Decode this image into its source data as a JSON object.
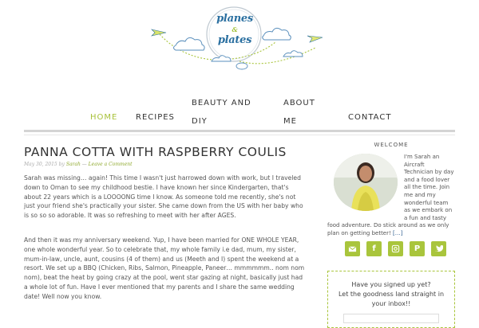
{
  "logo": {
    "line1": "planes",
    "amp": "&",
    "line2": "plates"
  },
  "nav": {
    "items": [
      {
        "label": "HOME",
        "active": true
      },
      {
        "label": "RECIPES",
        "active": false
      },
      {
        "label_line1": "BEAUTY AND",
        "label_line2": "DIY",
        "active": false
      },
      {
        "label_line1": "ABOUT",
        "label_line2": "ME",
        "active": false
      },
      {
        "label": "CONTACT",
        "active": false
      }
    ]
  },
  "post": {
    "title": "PANNA COTTA WITH RASPBERRY COULIS",
    "meta": {
      "date": "May 30, 2015",
      "by": "by",
      "author": "Sarah",
      "separator": "—",
      "comment": "Leave a Comment"
    },
    "paragraphs": [
      "Sarah was missing… again! This time I wasn't just harrowed down with work, but I traveled down to Oman to see my childhood bestie. I have known her since Kindergarten, that's about 22 years which is a LOOOONG time I know. As someone told me recently, she's not just your friend she's practically your sister. She came down from the US with her baby who is so so so adorable. It was so refreshing to meet with her after AGES.",
      "And then it was my anniversary weekend. Yup, I have been married for ONE WHOLE YEAR, one whole wonderful year. So to celebrate that, my whole family i.e dad, mum, my sister, mum-in-law, uncle, aunt, cousins (4 of them) and us (Meeth and I) spent the weekend at a resort. We set up a BBQ (Chicken, Ribs, Salmon, Pineapple, Paneer… mmmmmm.. nom nom nom), beat the heat by going crazy at the pool, went star gazing at night, basically just had a whole lot of fun. Have I ever mentioned that my parents and I share the same wedding date! Well now you know."
    ]
  },
  "sidebar": {
    "welcome_heading": "WELCOME",
    "intro_text": "I'm Sarah an Aircraft Technician by day and a food lover all the time. Join me and my wonderful team as we embark on a fun and tasty food adventure. Do stick around as we only plan on getting better!",
    "read_more": "[…]",
    "social": [
      {
        "icon": "email-icon"
      },
      {
        "icon": "facebook-icon",
        "glyph": "f"
      },
      {
        "icon": "instagram-icon"
      },
      {
        "icon": "pinterest-icon",
        "glyph": "P"
      },
      {
        "icon": "twitter-icon"
      }
    ],
    "signup_line1": "Have you signed up yet?",
    "signup_line2": "Let the goodness land straight in",
    "signup_line3": "your inbox!!"
  },
  "colors": {
    "accent": "#a9c53c",
    "nav_active": "#a8c23a",
    "logo_blue": "#2a6fa0"
  }
}
